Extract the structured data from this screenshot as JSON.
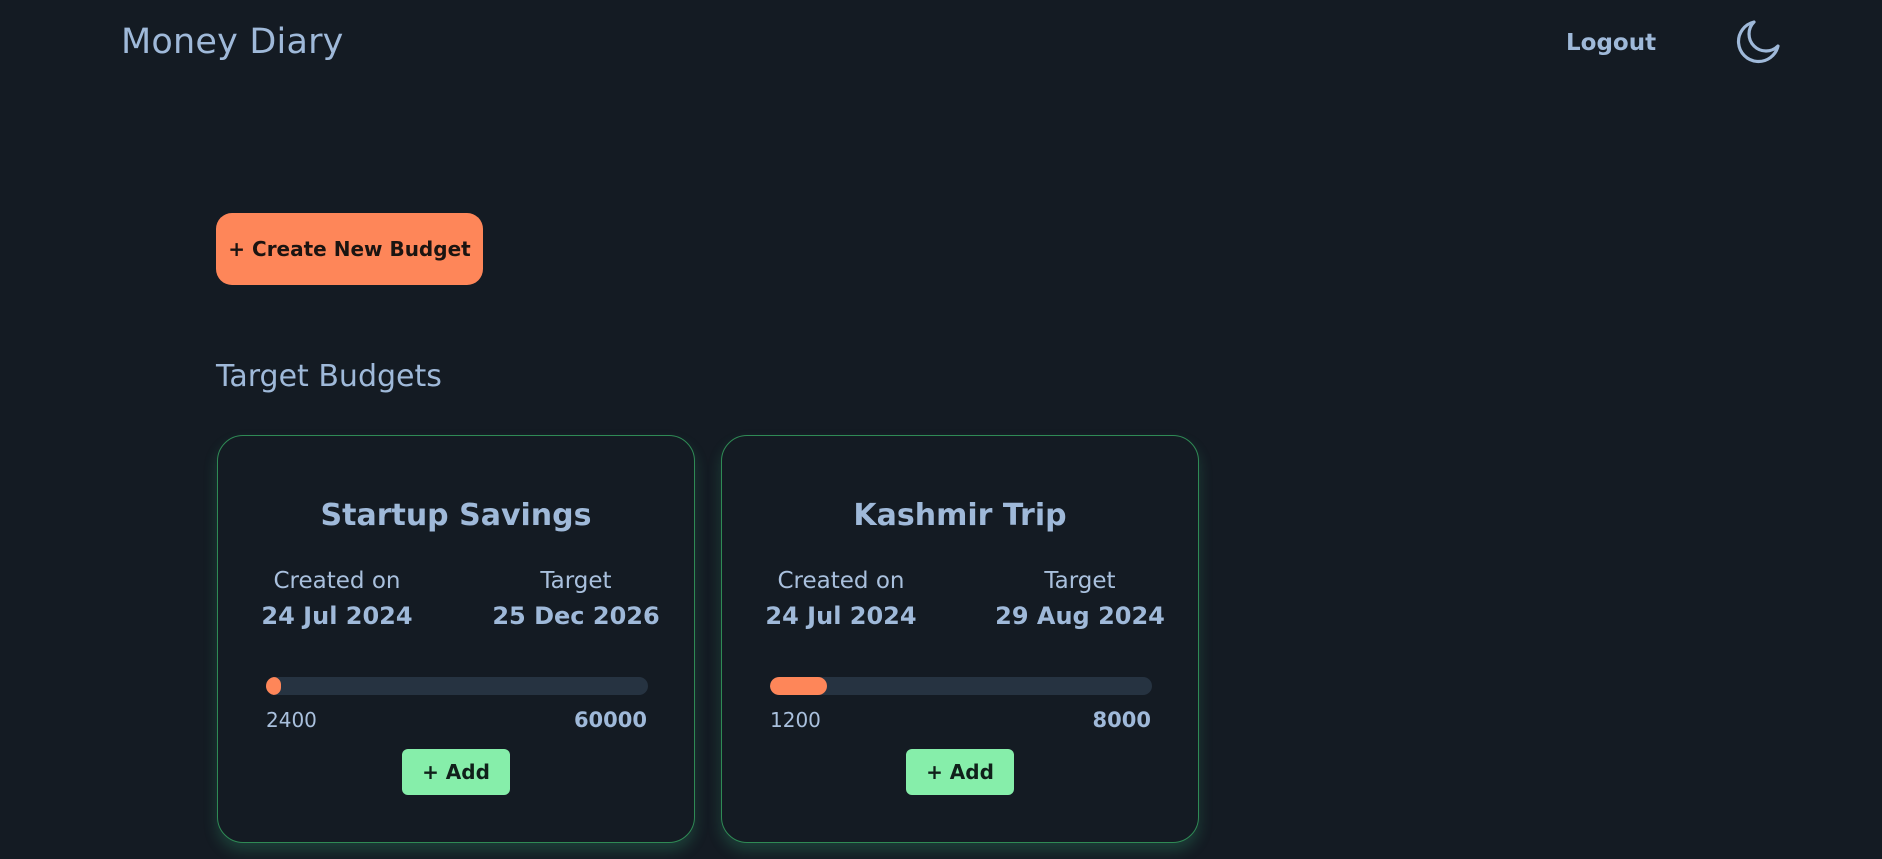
{
  "app": {
    "title": "Money Diary"
  },
  "nav": {
    "logout_label": "Logout",
    "theme_icon": "moon-icon"
  },
  "main": {
    "create_button_label": "+ Create New Budget",
    "section_title": "Target Budgets"
  },
  "budgets": [
    {
      "name": "Startup Savings",
      "created_label": "Created on",
      "created_date": "24 Jul 2024",
      "target_label": "Target",
      "target_date": "25 Dec 2026",
      "current_amount": "2400",
      "target_amount": "60000",
      "progress_fraction": 0.04,
      "add_label": "+ Add"
    },
    {
      "name": "Kashmir Trip",
      "created_label": "Created on",
      "created_date": "24 Jul 2024",
      "target_label": "Target",
      "target_date": "29 Aug 2024",
      "current_amount": "1200",
      "target_amount": "8000",
      "progress_fraction": 0.15,
      "add_label": "+ Add"
    }
  ],
  "colors": {
    "background": "#141b23",
    "text": "#9fb9d9",
    "accent_orange": "#fe8659",
    "accent_green": "#86eeaa",
    "card_border": "#2f8a55",
    "progress_track": "#263341"
  }
}
